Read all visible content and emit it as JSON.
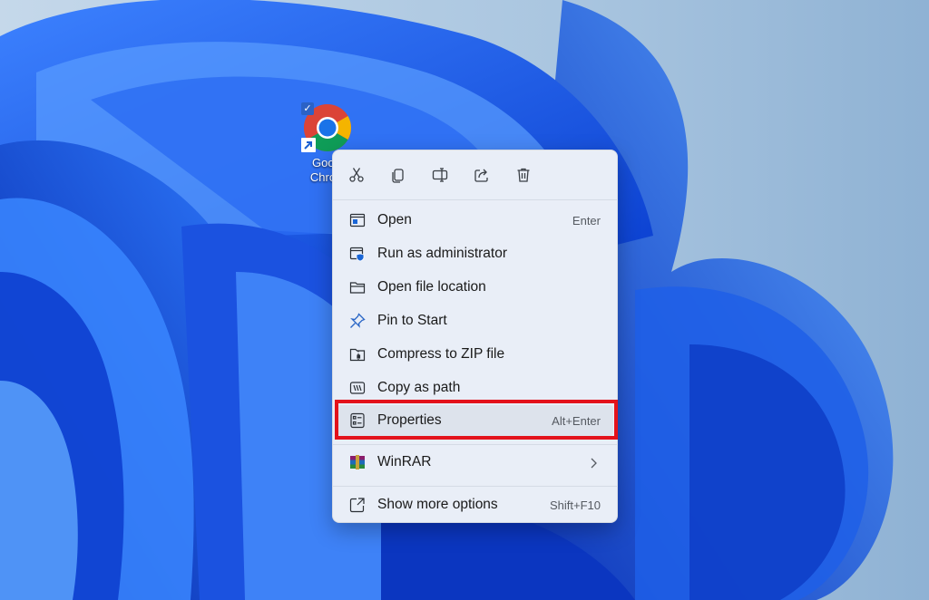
{
  "desktop": {
    "icon_label": "Google Chrome"
  },
  "context_menu": {
    "toolbar": [
      {
        "name": "cut-icon"
      },
      {
        "name": "copy-icon"
      },
      {
        "name": "rename-icon"
      },
      {
        "name": "share-icon"
      },
      {
        "name": "delete-icon"
      }
    ],
    "items": [
      {
        "label": "Open",
        "shortcut": "Enter"
      },
      {
        "label": "Run as administrator",
        "shortcut": ""
      },
      {
        "label": "Open file location",
        "shortcut": ""
      },
      {
        "label": "Pin to Start",
        "shortcut": ""
      },
      {
        "label": "Compress to ZIP file",
        "shortcut": ""
      },
      {
        "label": "Copy as path",
        "shortcut": ""
      },
      {
        "label": "Properties",
        "shortcut": "Alt+Enter"
      },
      {
        "label": "WinRAR",
        "shortcut": ""
      },
      {
        "label": "Show more options",
        "shortcut": "Shift+F10"
      }
    ],
    "highlight_color": "#e3121b"
  }
}
